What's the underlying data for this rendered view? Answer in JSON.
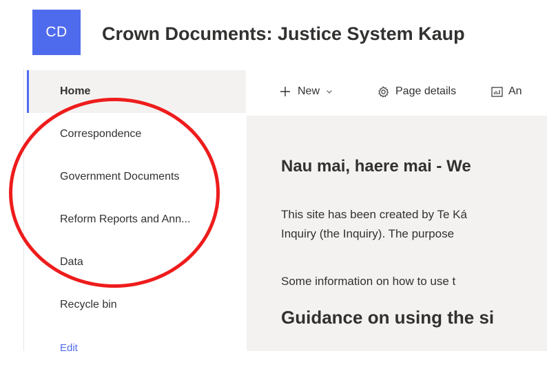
{
  "header": {
    "logo_text": "CD",
    "site_title": "Crown Documents: Justice System Kaup"
  },
  "sidebar": {
    "items": [
      {
        "label": "Home",
        "selected": true
      },
      {
        "label": "Correspondence"
      },
      {
        "label": "Government Documents"
      },
      {
        "label": "Reform Reports and Ann..."
      },
      {
        "label": "Data"
      },
      {
        "label": "Recycle bin"
      }
    ],
    "edit_label": "Edit"
  },
  "command_bar": {
    "new_label": "New",
    "page_details_label": "Page details",
    "analytics_label": "An"
  },
  "content": {
    "welcome_heading": "Nau mai, haere mai - We",
    "para1_line1": "This site has been created by Te Ká",
    "para1_line2": "Inquiry (the Inquiry). The purpose",
    "para2": "Some information on how to use t",
    "guidance_heading": "Guidance on using the si"
  },
  "colors": {
    "accent": "#4f6bed",
    "annotation": "#ee1c1c"
  }
}
